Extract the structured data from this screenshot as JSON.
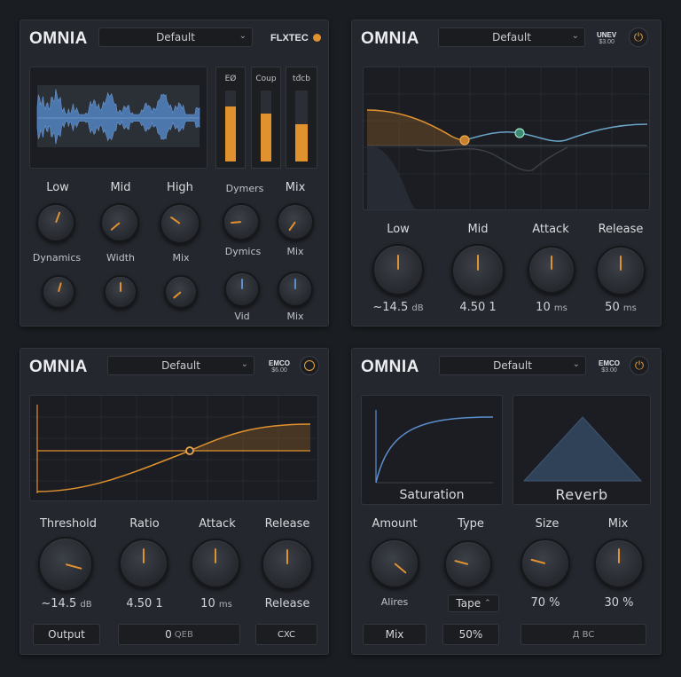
{
  "brand": "OMNIA",
  "colors": {
    "accent": "#e0922f",
    "blue": "#5b8fd0",
    "teal": "#6ec2a3",
    "panel": "#24272d",
    "bg": "#1a1d22"
  },
  "panels": [
    {
      "preset": "Default",
      "vendor": "FLXTEC",
      "meters": [
        {
          "label": "EØ",
          "level": 0.77
        },
        {
          "label": "Coup",
          "level": 0.68
        },
        {
          "label": "tđcb",
          "level": 0.53
        }
      ],
      "knobs_row1": [
        {
          "label": "Low",
          "angle": 20
        },
        {
          "label": "Mid",
          "angle": -130
        },
        {
          "label": "High",
          "angle": -55
        },
        {
          "label": "Dymers",
          "angle": -95
        },
        {
          "label": "Mix",
          "angle": -145
        }
      ],
      "knobs_row2": [
        {
          "label": "Dynamics",
          "angle": 15
        },
        {
          "label": "Width",
          "angle": 0
        },
        {
          "label": "Mix",
          "angle": -130
        },
        {
          "label": "Dymics",
          "bottom": "Vid",
          "angle": 0
        },
        {
          "label": "Mix",
          "bottom": "Mix",
          "angle": 0
        }
      ]
    },
    {
      "preset": "Default",
      "vendor": "UNEV",
      "price": "$3.00",
      "knobs": [
        {
          "label": "Low",
          "value": "~14.5",
          "unit": "dB",
          "angle": 0
        },
        {
          "label": "Mid",
          "value": "4.50 1",
          "unit": "",
          "angle": 0
        },
        {
          "label": "Attack",
          "value": "10",
          "unit": "ms",
          "angle": 0
        },
        {
          "label": "Release",
          "value": "50",
          "unit": "ms",
          "angle": 0
        }
      ]
    },
    {
      "preset": "Default",
      "vendor": "EMCO",
      "price": "$6.00",
      "knobs": [
        {
          "label": "Threshold",
          "value": "~14.5",
          "unit": "dB",
          "angle": 105
        },
        {
          "label": "Ratio",
          "value": "4.50 1",
          "unit": "",
          "angle": 0
        },
        {
          "label": "Attack",
          "value": "10",
          "unit": "ms",
          "angle": 0
        },
        {
          "label": "Release",
          "value": "Release",
          "unit": "",
          "angle": 0
        }
      ],
      "buttons": {
        "output": "Output",
        "mid_value": "0",
        "mid_unit": "QEB",
        "right": "CXC"
      }
    },
    {
      "preset": "Default",
      "vendor": "EMCO",
      "price": "$3.00",
      "screens": {
        "left": "Saturation",
        "right": "Reverb"
      },
      "knobs": [
        {
          "label": "Amount",
          "value": "Alires",
          "angle": 130
        },
        {
          "label": "Type",
          "value": "Tape",
          "angle": -75
        },
        {
          "label": "Size",
          "value": "70 %",
          "angle": -75
        },
        {
          "label": "Mix",
          "value": "30 %",
          "angle": 0
        }
      ],
      "buttons": {
        "mix": "Mix",
        "mix_value": "50%",
        "right": "Д ВС"
      }
    }
  ]
}
